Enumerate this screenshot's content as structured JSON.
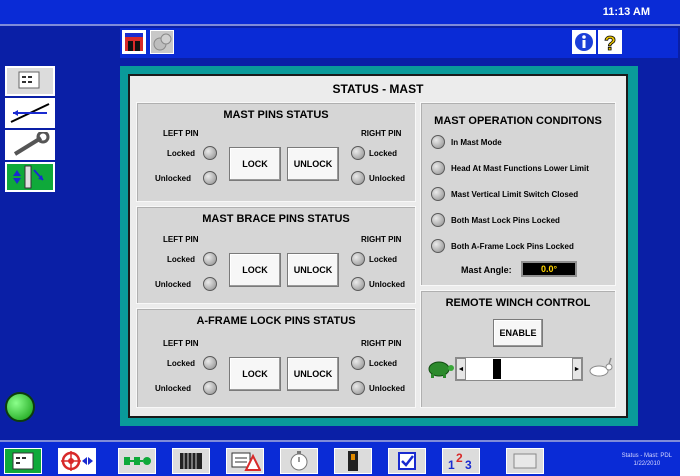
{
  "clock": "11:13 AM",
  "panel_title": "STATUS - MAST",
  "mast_pins": {
    "title": "MAST  PINS STATUS",
    "left_pin": "LEFT PIN",
    "right_pin": "RIGHT PIN",
    "locked": "Locked",
    "unlocked": "Unlocked",
    "lock_btn": "LOCK",
    "unlock_btn": "UNLOCK"
  },
  "mast_brace": {
    "title": "MAST BRACE PINS STATUS",
    "left_pin": "LEFT PIN",
    "right_pin": "RIGHT PIN",
    "locked": "Locked",
    "unlocked": "Unlocked",
    "lock_btn": "LOCK",
    "unlock_btn": "UNLOCK"
  },
  "aframe": {
    "title": "A-FRAME LOCK PINS STATUS",
    "left_pin": "LEFT PIN",
    "right_pin": "RIGHT PIN",
    "locked": "Locked",
    "unlocked": "Unlocked",
    "lock_btn": "LOCK",
    "unlock_btn": "UNLOCK"
  },
  "operation": {
    "title": "MAST OPERATION CONDITONS",
    "conditions": [
      "In Mast Mode",
      "Head At Mast Functions Lower Limit",
      "Mast Vertical Limit Switch Closed",
      "Both Mast Lock Pins Locked",
      "Both A-Frame Lock Pins Locked"
    ],
    "angle_label": "Mast Angle:",
    "angle_value": "0.0°"
  },
  "winch": {
    "title": "REMOTE WINCH CONTROL",
    "enable_btn": "ENABLE",
    "slider_value_percent": 28
  },
  "footer": {
    "line1": "Status - Mast: PDL",
    "line2": "1/22/2010"
  },
  "colors": {
    "frame": "#0a1fa6",
    "panel_bg": "#0a9a9a",
    "active_green": "#0fa93a",
    "angle_text": "#ffd400"
  }
}
